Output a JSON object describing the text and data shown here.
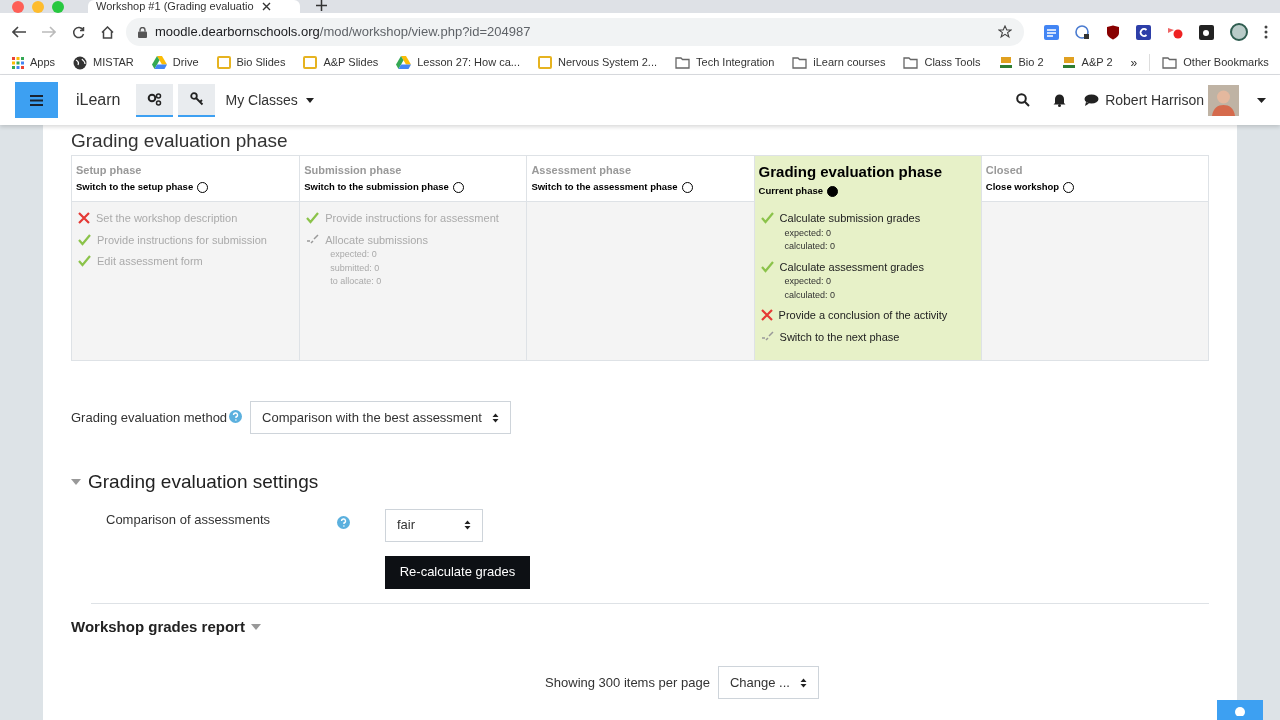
{
  "browser": {
    "tab_title": "Workshop #1 (Grading evaluatio",
    "url_host": "moodle.dearbornschools.org",
    "url_path": "/mod/workshop/view.php?id=204987",
    "bookmarks": [
      {
        "kind": "apps",
        "label": "Apps"
      },
      {
        "kind": "globe",
        "label": "MISTAR"
      },
      {
        "kind": "drive",
        "label": "Drive"
      },
      {
        "kind": "slides",
        "label": "Bio Slides"
      },
      {
        "kind": "slides",
        "label": "A&P Slides"
      },
      {
        "kind": "drive",
        "label": "Lesson 27: How ca..."
      },
      {
        "kind": "slides",
        "label": "Nervous System 2..."
      },
      {
        "kind": "folder",
        "label": "Tech Integration"
      },
      {
        "kind": "folder",
        "label": "iLearn courses"
      },
      {
        "kind": "folder",
        "label": "Class Tools"
      },
      {
        "kind": "site",
        "label": "Bio 2"
      },
      {
        "kind": "site",
        "label": "A&P 2"
      }
    ],
    "more": "»",
    "other_bookmarks": "Other Bookmarks"
  },
  "navbar": {
    "brand": "iLearn",
    "menu": "My Classes",
    "user": "Robert Harrison"
  },
  "page_title": "Grading evaluation phase",
  "phases": [
    {
      "title": "Setup phase",
      "action": "Switch to the setup phase",
      "selected": false,
      "tasks": [
        {
          "kind": "fail",
          "label": "Set the workshop description"
        },
        {
          "kind": "done",
          "label": "Provide instructions for submission"
        },
        {
          "kind": "done",
          "label": "Edit assessment form"
        }
      ]
    },
    {
      "title": "Submission phase",
      "action": "Switch to the submission phase",
      "selected": false,
      "tasks": [
        {
          "kind": "done",
          "label": "Provide instructions for assessment"
        },
        {
          "kind": "info",
          "label": "Allocate submissions",
          "details": [
            "expected: 0",
            "submitted: 0",
            "to allocate: 0"
          ]
        }
      ]
    },
    {
      "title": "Assessment phase",
      "action": "Switch to the assessment phase",
      "selected": false
    },
    {
      "title": "Grading evaluation phase",
      "action": "Current phase",
      "selected": true,
      "tasks": [
        {
          "kind": "done",
          "label": "Calculate submission grades",
          "details": [
            "expected: 0",
            "calculated: 0"
          ]
        },
        {
          "kind": "done",
          "label": "Calculate assessment grades",
          "details": [
            "expected: 0",
            "calculated: 0"
          ]
        },
        {
          "kind": "fail",
          "label": "Provide a conclusion of the activity"
        },
        {
          "kind": "info",
          "label": "Switch to the next phase"
        }
      ]
    },
    {
      "title": "Closed",
      "action": "Close workshop",
      "selected": false
    }
  ],
  "method": {
    "label": "Grading evaluation method",
    "value": "Comparison with the best assessment"
  },
  "settings": {
    "title": "Grading evaluation settings",
    "expanded": true,
    "field_label": "Comparison of assessments",
    "value": "fair",
    "button": "Re-calculate grades"
  },
  "report": {
    "title": "Workshop grades report",
    "per_page": "Showing 300 items per page",
    "change": "Change ..."
  }
}
